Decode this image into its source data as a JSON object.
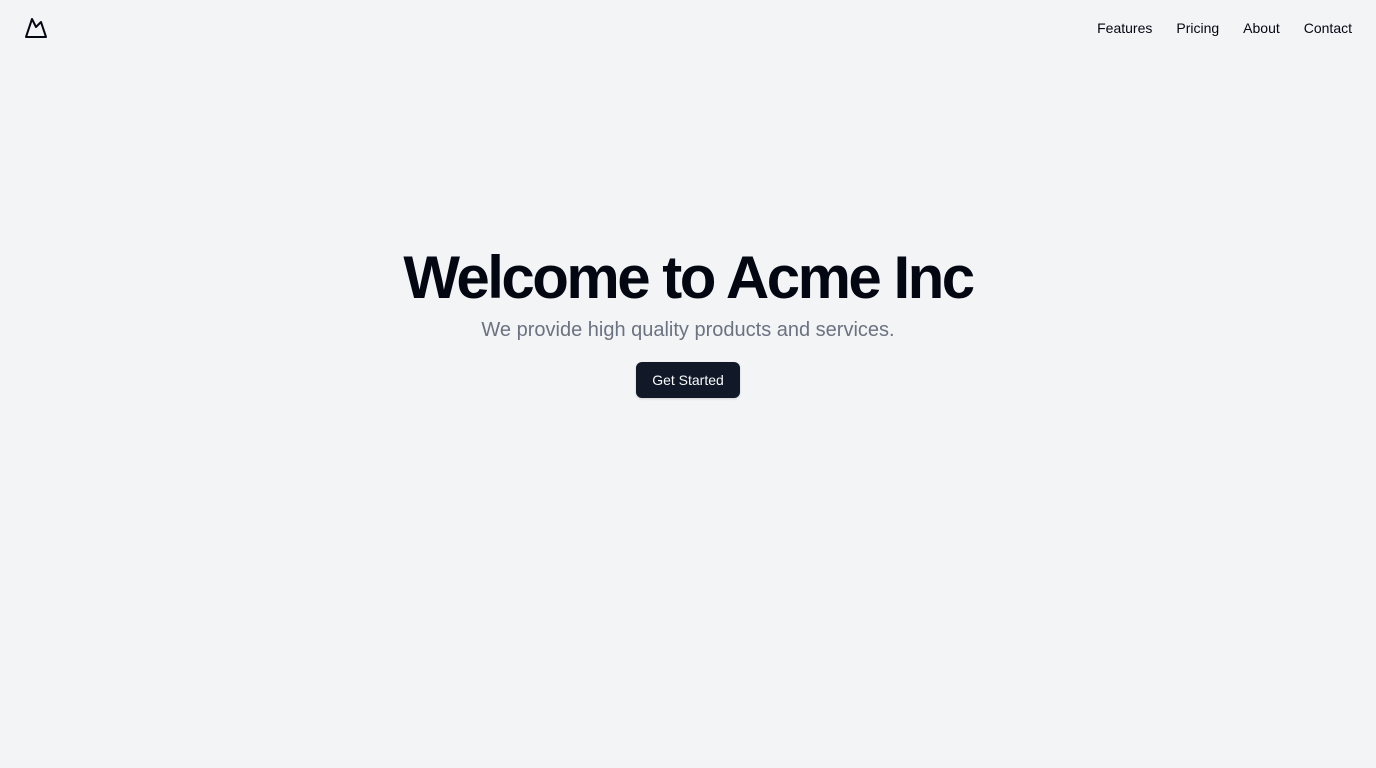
{
  "header": {
    "logo_icon": "mountain-icon",
    "nav_items": [
      {
        "label": "Features"
      },
      {
        "label": "Pricing"
      },
      {
        "label": "About"
      },
      {
        "label": "Contact"
      }
    ]
  },
  "hero": {
    "title": "Welcome to Acme Inc",
    "subtitle": "We provide high quality products and services.",
    "cta_label": "Get Started"
  },
  "colors": {
    "background": "#f3f4f6",
    "text": "#030712",
    "muted_text": "#6b7280",
    "button_background": "#111827",
    "button_text": "#f9fafb"
  }
}
